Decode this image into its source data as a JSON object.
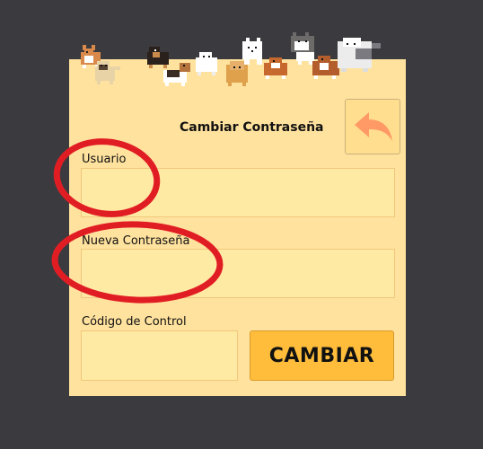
{
  "form": {
    "title": "Cambiar Contraseña",
    "user_label": "Usuario",
    "user_value": "",
    "user_placeholder": "",
    "new_password_label": "Nueva Contraseña",
    "new_password_value": "",
    "new_password_placeholder": "",
    "control_code_label": "Código de Control",
    "control_code_value": "",
    "control_code_placeholder": "",
    "submit_label": "CAMBIAR",
    "back_icon": "back-arrow-icon"
  },
  "colors": {
    "background": "#3b3b3f",
    "panel": "#ffe29e",
    "field": "#ffeaa3",
    "button": "#ffbd3b",
    "back_arrow": "#ff9a66",
    "annotation": "#e11d24"
  },
  "decoration": {
    "banner": "pixel-dogs-banner"
  }
}
